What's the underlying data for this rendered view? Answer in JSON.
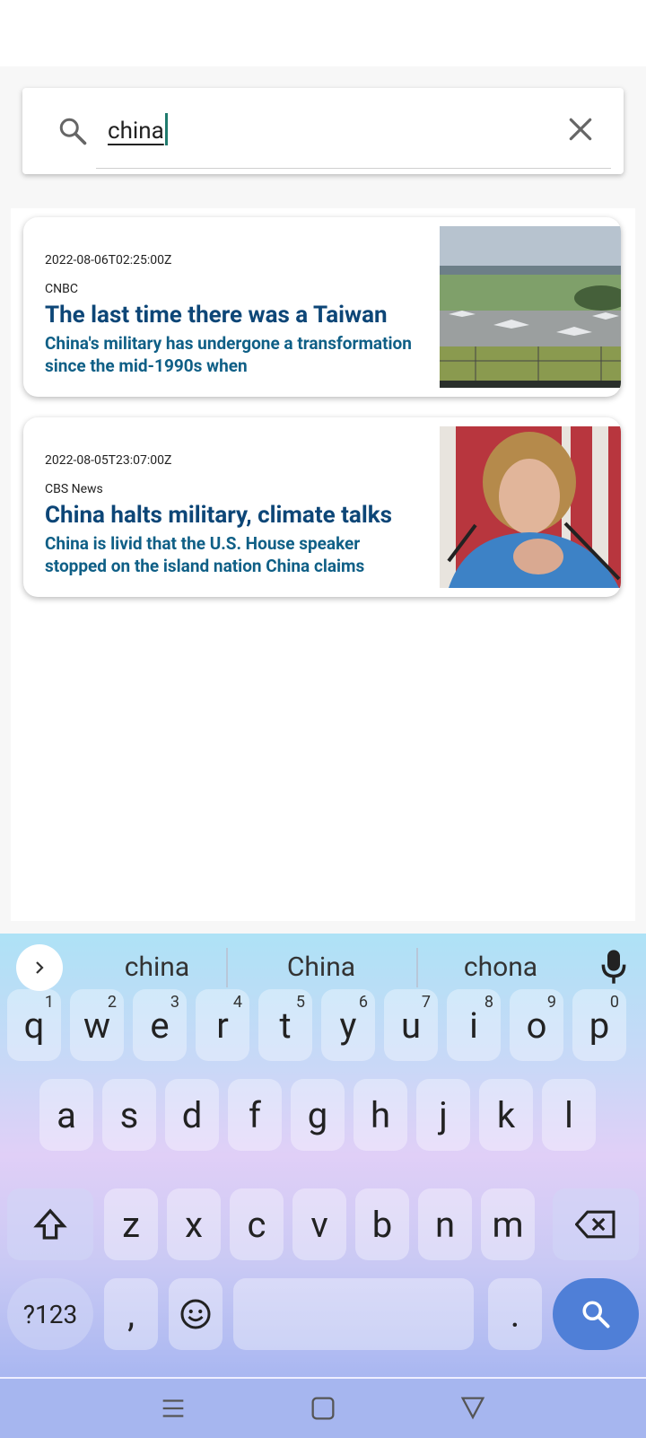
{
  "search": {
    "query": "china",
    "icons": {
      "search": "search-icon",
      "clear": "close-icon"
    }
  },
  "results": [
    {
      "date": "2022-08-06T02:25:00Z",
      "source": "CNBC",
      "title": "The last time there was a Taiwan",
      "snippet": "China's military has undergone a transformation since the mid-1990s when",
      "image": "fighter-jets-on-runway"
    },
    {
      "date": "2022-08-05T23:07:00Z",
      "source": "CBS News",
      "title": "China halts military, climate talks",
      "snippet": "China is livid that the U.S. House speaker stopped on the island nation China claims",
      "image": "speaker-at-microphones"
    }
  ],
  "keyboard": {
    "suggestions": [
      "china",
      "China",
      "chona"
    ],
    "row1": [
      {
        "k": "q",
        "h": "1"
      },
      {
        "k": "w",
        "h": "2"
      },
      {
        "k": "e",
        "h": "3"
      },
      {
        "k": "r",
        "h": "4"
      },
      {
        "k": "t",
        "h": "5"
      },
      {
        "k": "y",
        "h": "6"
      },
      {
        "k": "u",
        "h": "7"
      },
      {
        "k": "i",
        "h": "8"
      },
      {
        "k": "o",
        "h": "9"
      },
      {
        "k": "p",
        "h": "0"
      }
    ],
    "row2": [
      "a",
      "s",
      "d",
      "f",
      "g",
      "h",
      "j",
      "k",
      "l"
    ],
    "row3": [
      "z",
      "x",
      "c",
      "v",
      "b",
      "n",
      "m"
    ],
    "symbols_label": "?123",
    "comma": ",",
    "period": "."
  },
  "colors": {
    "title": "#0d4677",
    "snippet": "#0f5f86",
    "search_key": "#4f7fd7",
    "cursor": "#1f7a6d"
  }
}
